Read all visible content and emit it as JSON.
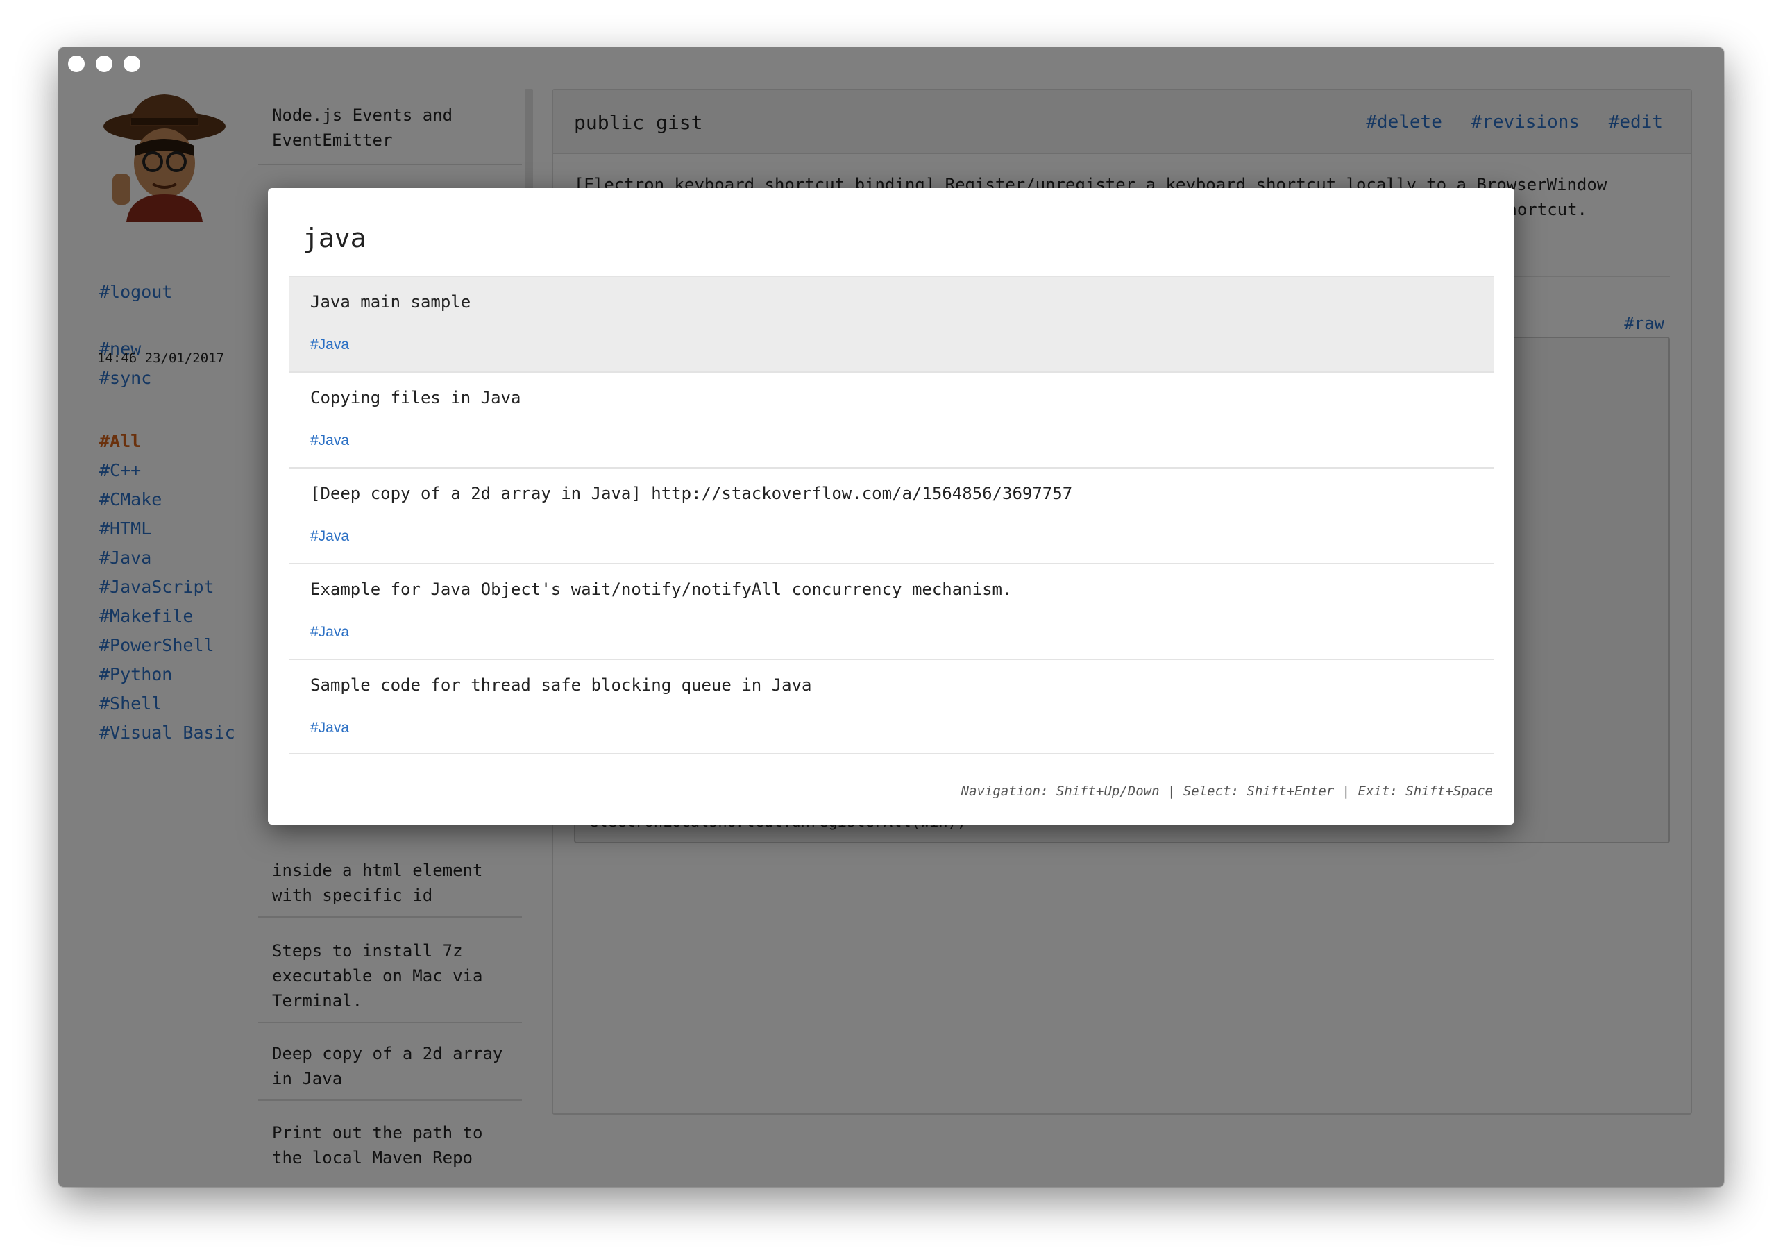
{
  "sidebar": {
    "logout": "#logout",
    "new": "#new",
    "sync": "#sync",
    "sync_time": "14:46 23/01/2017",
    "languages": [
      "#All",
      "#C++",
      "#CMake",
      "#HTML",
      "#Java",
      "#JavaScript",
      "#Makefile",
      "#PowerShell",
      "#Python",
      "#Shell",
      "#Visual Basic"
    ]
  },
  "gist_list": {
    "first": "Node.js Events and EventEmitter",
    "items": [
      "inside a html element with specific id",
      "Steps to install 7z executable on Mac via Terminal.",
      "Deep copy of a 2d array in Java",
      "Print out the path to the local Maven Repo"
    ]
  },
  "detail": {
    "title": "public gist",
    "actions": {
      "delete": "#delete",
      "revisions": "#revisions",
      "edit": "#edit"
    },
    "description": "[Electron keyboard shortcut binding] Register/unregister a keyboard shortcut locally to a BrowserWindow",
    "description_tail": "hortcut.",
    "raw": "#raw",
    "code_last_line": "electronLocalshortcut.unregisterAll(win);"
  },
  "modal": {
    "query": "java",
    "results": [
      {
        "title": "Java main sample",
        "tag": "#Java"
      },
      {
        "title": "Copying files in Java",
        "tag": "#Java"
      },
      {
        "title": "[Deep copy of a 2d array in Java] http://stackoverflow.com/a/1564856/3697757",
        "tag": "#Java"
      },
      {
        "title": "Example for Java Object's wait/notify/notifyAll concurrency mechanism.",
        "tag": "#Java"
      },
      {
        "title": "Sample code for thread safe blocking queue in Java",
        "tag": "#Java"
      }
    ],
    "hint": "Navigation: Shift+Up/Down | Select: Shift+Enter | Exit: Shift+Space"
  },
  "colors": {
    "link": "#2a6fc4",
    "active_link": "#d4631a"
  }
}
